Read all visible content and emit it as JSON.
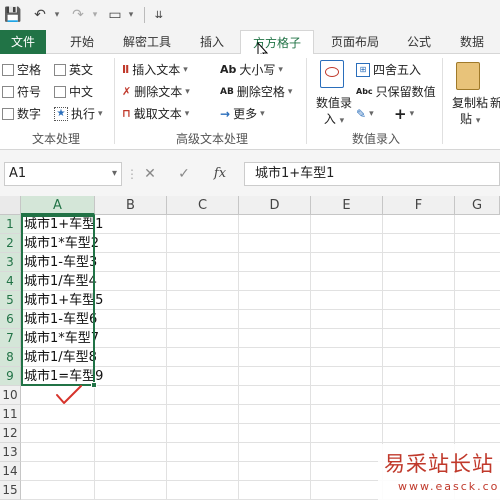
{
  "quick_access": {
    "save": "💾",
    "undo": "↶",
    "redo": "↷",
    "customize": "▭",
    "more": "⇊"
  },
  "tabs": [
    {
      "label": "文件"
    },
    {
      "label": "开始"
    },
    {
      "label": "解密工具"
    },
    {
      "label": "插入"
    },
    {
      "label": "方方格子"
    },
    {
      "label": "页面布局"
    },
    {
      "label": "公式"
    },
    {
      "label": "数据"
    }
  ],
  "ribbon": {
    "text_group": {
      "items": [
        "空格",
        "英文",
        "符号",
        "中文",
        "数字"
      ],
      "execute": "执行",
      "name": "文本处理"
    },
    "advanced_group": {
      "insert": "插入文本",
      "delete": "删除文本",
      "extract": "截取文本",
      "case": "大小写",
      "case_prefix": "Ab",
      "delete_space": "删除空格",
      "delete_space_prefix": "AB",
      "more": "更多",
      "name": "高级文本处理"
    },
    "numeric_group": {
      "entry_label": "数值录",
      "entry_label2": "入",
      "round": "四舍五入",
      "keep_numeric": "只保留数值",
      "keep_prefix": "Abc",
      "name": "数值录入"
    },
    "clipboard": {
      "label": "复制粘",
      "label2": "贴",
      "extra": "新"
    }
  },
  "formula_bar": {
    "name_box": "A1",
    "cancel": "✕",
    "enter": "✓",
    "fx": "fx",
    "content": "城市1+车型1"
  },
  "sheet": {
    "columns": [
      "A",
      "B",
      "C",
      "D",
      "E",
      "F",
      "G"
    ],
    "rows": [
      "1",
      "2",
      "3",
      "4",
      "5",
      "6",
      "7",
      "8",
      "9",
      "10",
      "11",
      "12",
      "13",
      "14",
      "15"
    ],
    "cells_a": [
      "城市1+车型1",
      "城市1*车型2",
      "城市1-车型3",
      "城市1/车型4",
      "城市1+车型5",
      "城市1-车型6",
      "城市1*车型7",
      "城市1/车型8",
      "城市1=车型9"
    ]
  },
  "watermark": {
    "top": "易采站长站",
    "bottom": "www.easck.com"
  },
  "colors": {
    "excel_green": "#217346",
    "check_red": "#d6332b"
  }
}
